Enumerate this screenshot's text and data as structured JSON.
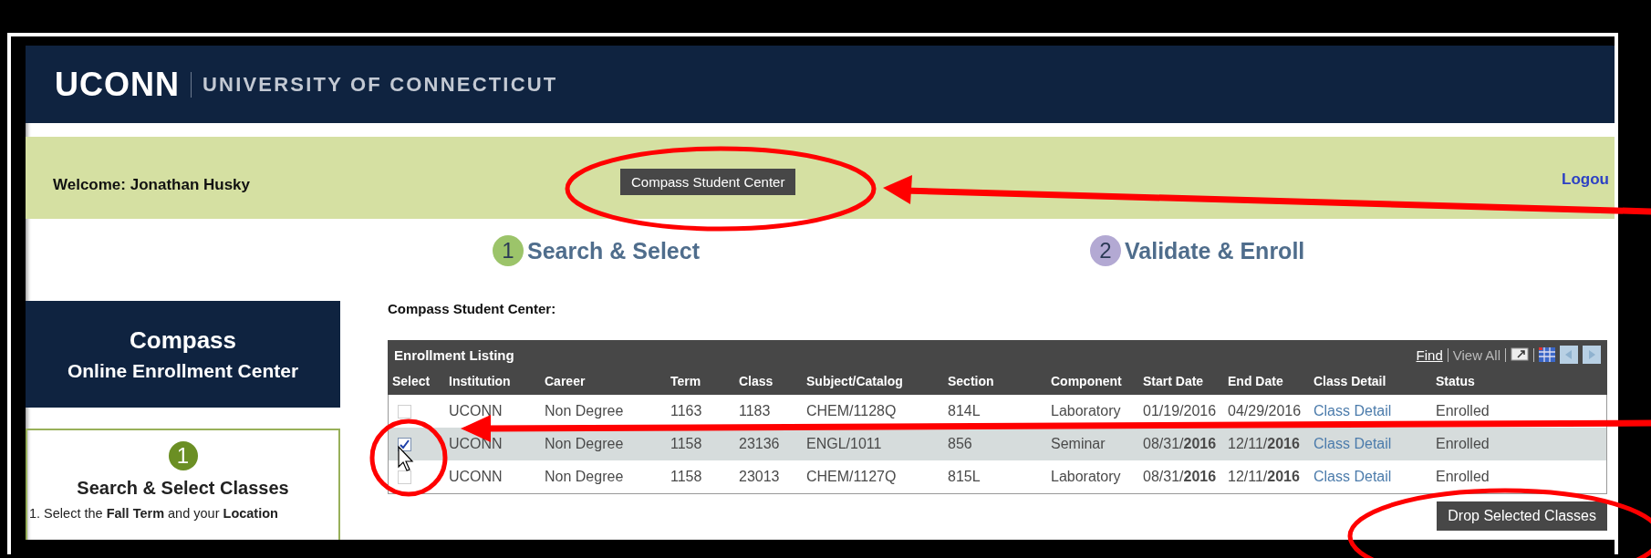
{
  "header": {
    "logo": "UCONN",
    "title": "UNIVERSITY OF CONNECTICUT"
  },
  "welcome_bar": {
    "welcome": "Welcome: Jonathan Husky",
    "center_button": "Compass Student Center",
    "logout_link": "Logou"
  },
  "steps": [
    {
      "number": "1",
      "label": "Search & Select",
      "color": "#9cc46a"
    },
    {
      "number": "2",
      "label": "Validate & Enroll",
      "color": "#b3a9d3"
    }
  ],
  "sidebar": {
    "title": "Compass",
    "subtitle": "Online Enrollment Center",
    "step_number": "1",
    "step_title": "Search & Select Classes",
    "instruction": "1. Select the **Fall Term** and your **Location**"
  },
  "page_heading": "Compass Student Center:",
  "table": {
    "title": "Enrollment Listing",
    "find_link": "Find",
    "view_all_link": "View All",
    "columns": [
      {
        "label": "Select",
        "kind": "check"
      },
      {
        "label": "Institution",
        "kind": "text"
      },
      {
        "label": "Career",
        "kind": "text"
      },
      {
        "label": "Term",
        "kind": "text"
      },
      {
        "label": "Class",
        "kind": "text"
      },
      {
        "label": "Subject/Catalog",
        "kind": "text"
      },
      {
        "label": "Section",
        "kind": "text"
      },
      {
        "label": "Component",
        "kind": "text"
      },
      {
        "label": "Start Date",
        "kind": "text"
      },
      {
        "label": "End Date",
        "kind": "text"
      },
      {
        "label": "Class Detail",
        "kind": "link"
      },
      {
        "label": "Status",
        "kind": "text"
      }
    ],
    "rows": [
      {
        "selected": false,
        "cells": [
          "",
          "UCONN",
          "Non Degree",
          "1163",
          "1183",
          "CHEM/1128Q",
          "814L",
          "Laboratory",
          "01/19/2016",
          "04/29/2016",
          "Class Detail",
          "Enrolled"
        ]
      },
      {
        "selected": true,
        "cells": [
          "",
          "UCONN",
          "Non Degree",
          "1158",
          "23136",
          "ENGL/1011",
          "856",
          "Seminar",
          "08/31/**2016**",
          "12/11/**2016**",
          "Class Detail",
          "Enrolled"
        ]
      },
      {
        "selected": false,
        "cells": [
          "",
          "UCONN",
          "Non Degree",
          "1158",
          "23013",
          "CHEM/1127Q",
          "815L",
          "Laboratory",
          "08/31/**2016**",
          "12/11/**2016**",
          "Class Detail",
          "Enrolled"
        ]
      }
    ]
  },
  "drop_button": "Drop Selected Classes"
}
